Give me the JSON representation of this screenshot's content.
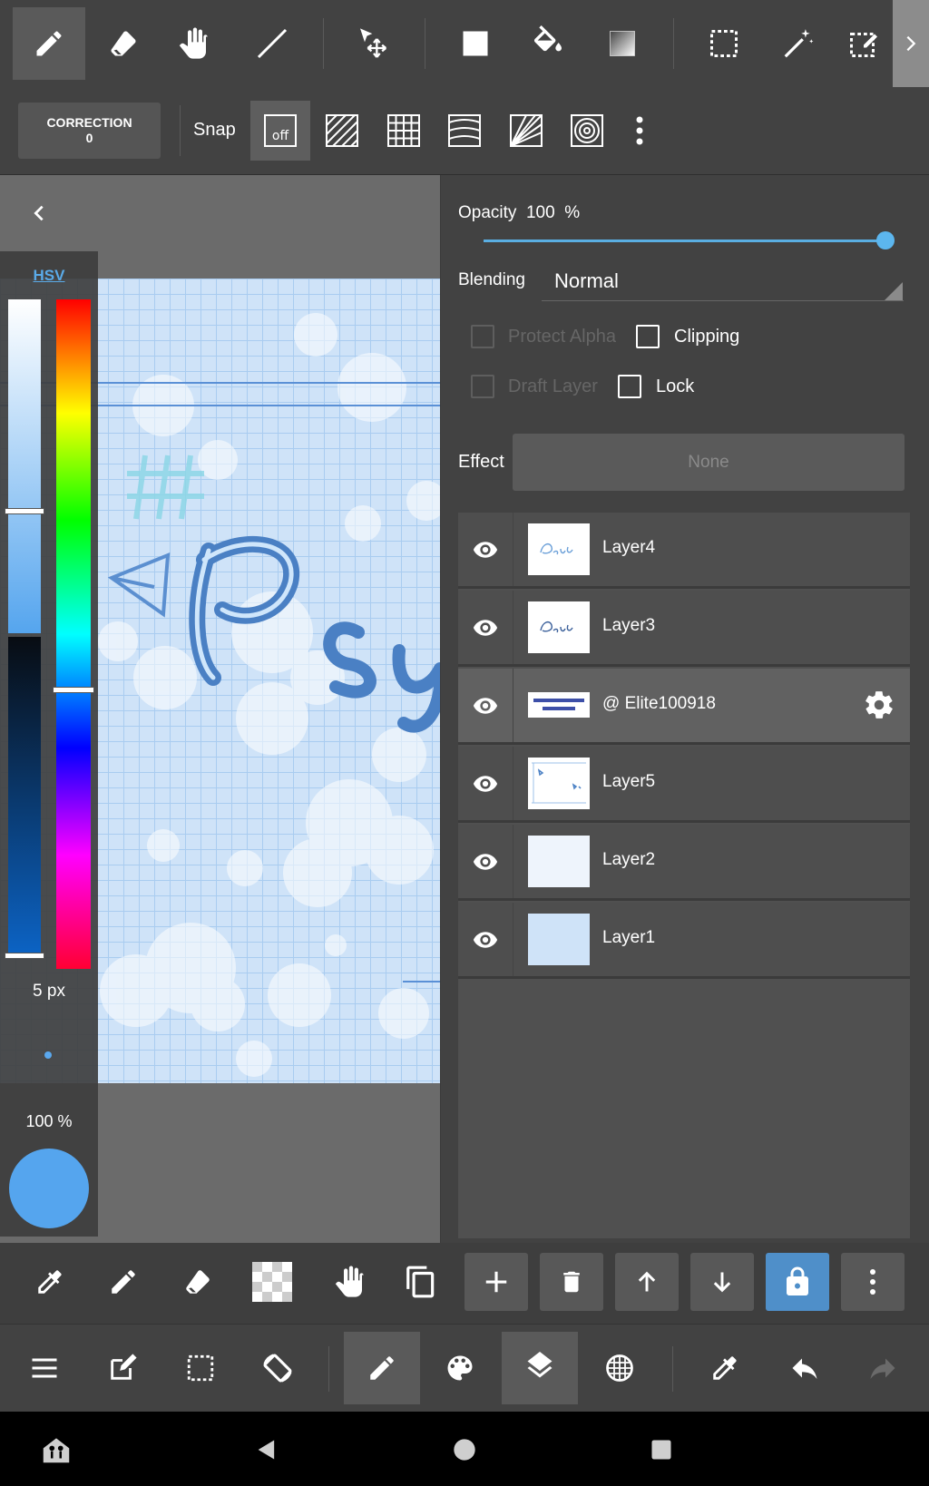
{
  "snapbar": {
    "correction_label": "CORRECTION",
    "correction_value": "0",
    "snap_label": "Snap",
    "snap_off_label": "off"
  },
  "color_panel": {
    "mode_label": "HSV",
    "brush_size": "5 px",
    "brush_opacity": "100 %",
    "current_color": "#55a5ee"
  },
  "layer_props": {
    "opacity_label": "Opacity",
    "opacity_value": "100",
    "opacity_unit": "%",
    "opacity_fraction": 1.0,
    "blending_label": "Blending",
    "blending_value": "Normal",
    "protect_alpha_label": "Protect Alpha",
    "clipping_label": "Clipping",
    "draft_layer_label": "Draft Layer",
    "lock_label": "Lock",
    "effect_label": "Effect",
    "effect_value": "None"
  },
  "layers": [
    {
      "name": "Layer4",
      "visible": true,
      "selected": false
    },
    {
      "name": "Layer3",
      "visible": true,
      "selected": false
    },
    {
      "name": "@ Elite100918",
      "visible": true,
      "selected": true
    },
    {
      "name": "Layer5",
      "visible": true,
      "selected": false
    },
    {
      "name": "Layer2",
      "visible": true,
      "selected": false
    },
    {
      "name": "Layer1",
      "visible": true,
      "selected": false
    }
  ],
  "colors": {
    "accent": "#5aaee2",
    "lock_active": "#4f8fc9",
    "panel": "#424242"
  }
}
